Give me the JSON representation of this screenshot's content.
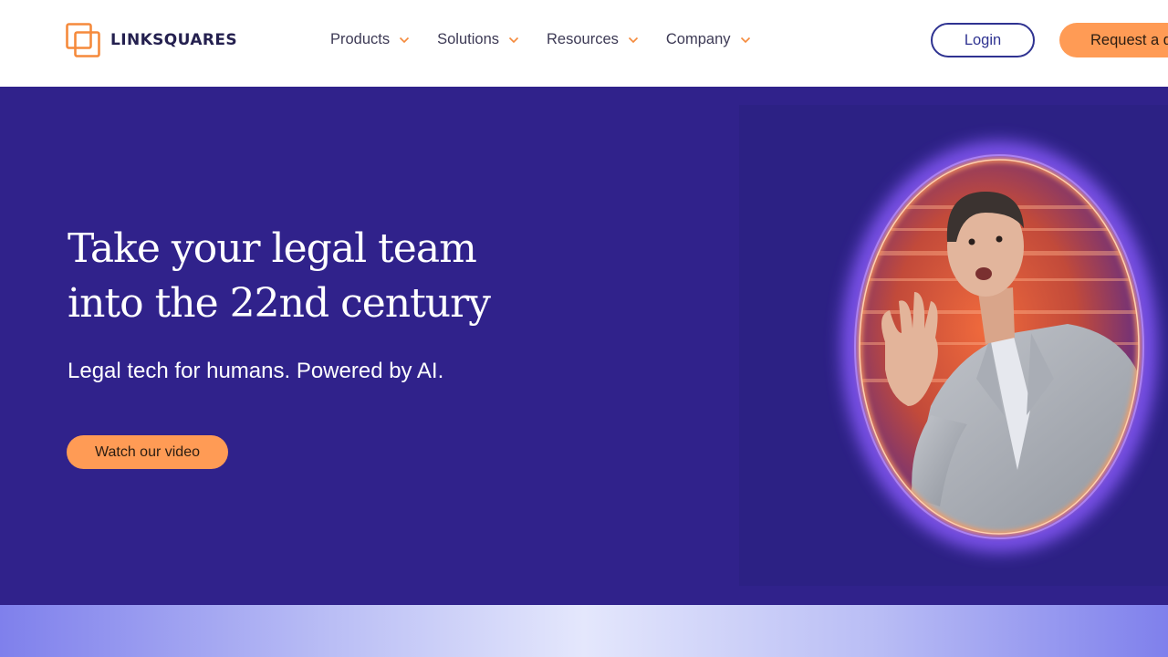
{
  "brand": {
    "name": "LINKSQUARES",
    "logo_color": "#f58a3c",
    "text_color": "#24204f"
  },
  "nav": {
    "items": [
      {
        "label": "Products",
        "icon": "chevron-down-icon"
      },
      {
        "label": "Solutions",
        "icon": "chevron-down-icon"
      },
      {
        "label": "Resources",
        "icon": "chevron-down-icon"
      },
      {
        "label": "Company",
        "icon": "chevron-down-icon"
      }
    ],
    "login_label": "Login",
    "demo_label": "Request a demo"
  },
  "hero": {
    "title_line1": "Take your legal team",
    "title_line2": "into the 22nd century",
    "subtitle": "Legal tech for humans. Powered by AI.",
    "cta_label": "Watch our video",
    "image": "man-waving-through-glowing-portal",
    "background": "#30228b"
  },
  "colors": {
    "accent": "#ff9b55",
    "primary": "#2f3391",
    "portal_glow": "#a77bff"
  }
}
